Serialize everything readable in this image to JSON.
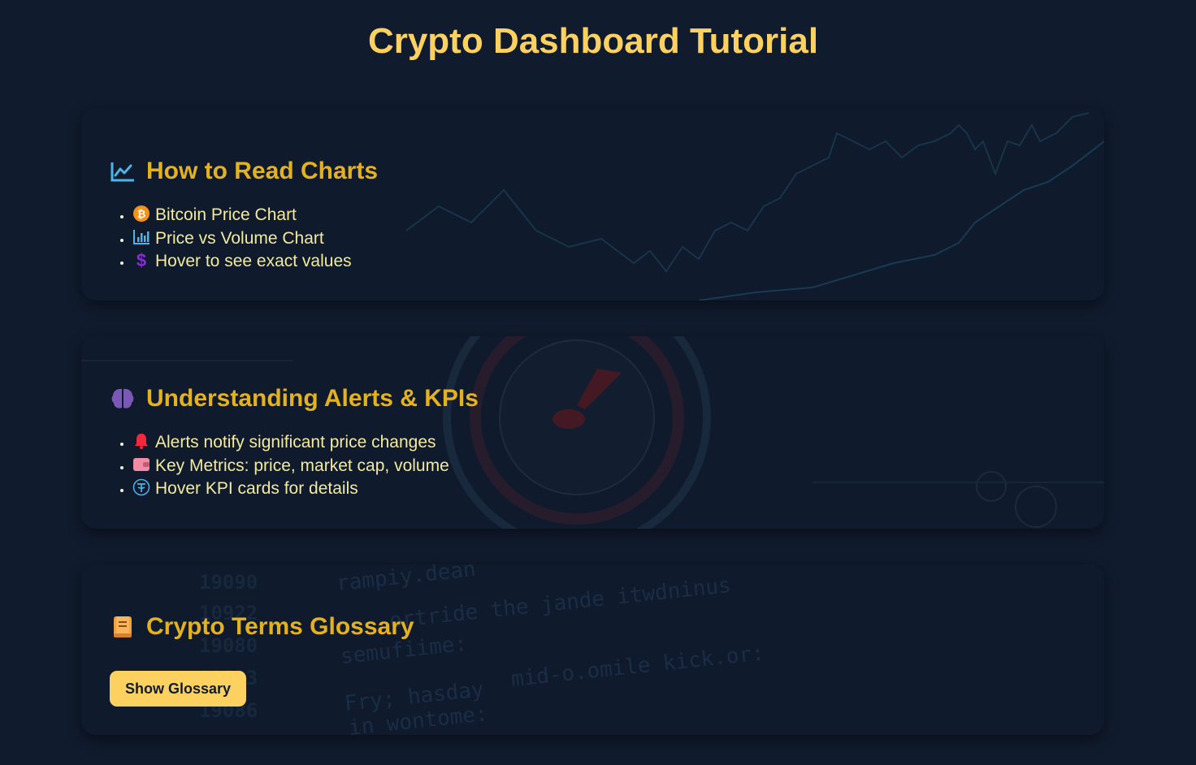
{
  "page": {
    "title": "Crypto Dashboard Tutorial"
  },
  "sections": [
    {
      "icon": "chart-line-icon",
      "heading": "How to Read Charts",
      "items": [
        {
          "icon": "bitcoin-icon",
          "text": "Bitcoin Price Chart"
        },
        {
          "icon": "bar-chart-icon",
          "text": "Price vs Volume Chart"
        },
        {
          "icon": "dollar-icon",
          "text": "Hover to see exact values"
        }
      ]
    },
    {
      "icon": "brain-icon",
      "heading": "Understanding Alerts & KPIs",
      "items": [
        {
          "icon": "bell-icon",
          "text": "Alerts notify significant price changes"
        },
        {
          "icon": "wallet-icon",
          "text": "Key Metrics: price, market cap, volume"
        },
        {
          "icon": "tether-icon",
          "text": "Hover KPI cards for details"
        }
      ]
    },
    {
      "icon": "book-icon",
      "heading": "Crypto Terms Glossary",
      "button": "Show Glossary"
    }
  ],
  "background_text": {
    "line1": "rampiy.dean",
    "line2": "ortride the jande itwdninus",
    "line3": "semufiime:",
    "line4": "mid-o.omile kick.or:",
    "line5": "Fry; hasday",
    "line6": "in wontome:",
    "num1": "19090",
    "num2": "10922",
    "num3": "19080",
    "num4": "10823",
    "num5": "19086"
  },
  "colors": {
    "background": "#101b2d",
    "card": "#0f1a2c",
    "title": "#fcd15f",
    "heading": "#e5b21f",
    "text": "#f3ea9c",
    "button": "#fcd15f"
  }
}
